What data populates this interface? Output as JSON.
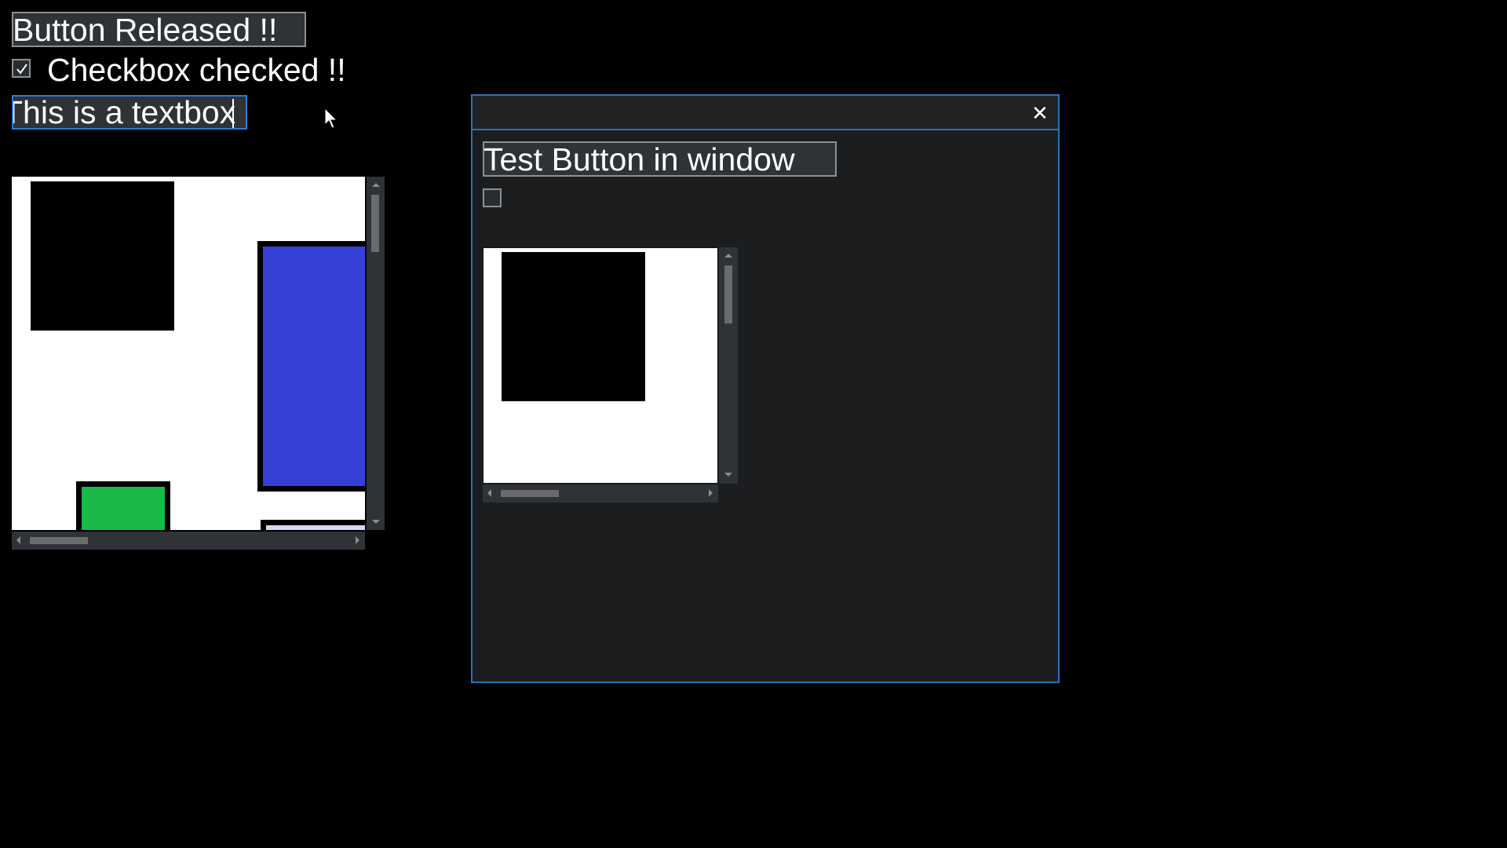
{
  "main": {
    "button_label": "Button Released !!",
    "checkbox_label": "Checkbox checked !!",
    "checkbox_checked": true,
    "textbox_value": "This is a textbox"
  },
  "canvas_panel": {
    "shapes": [
      {
        "name": "black-square",
        "fill": "#000000"
      },
      {
        "name": "blue-rectangle",
        "fill": "#3440d6"
      },
      {
        "name": "green-rectangle",
        "fill": "#18b946"
      },
      {
        "name": "lavender-rectangle",
        "fill": "#dcd6f7"
      }
    ]
  },
  "window": {
    "title": "",
    "close_label": "✕",
    "button_label": "Test Button in window",
    "checkbox_checked": false,
    "canvas_shapes": [
      {
        "name": "black-square",
        "fill": "#000000"
      }
    ]
  },
  "colors": {
    "accent": "#2d6fb8",
    "window_bg": "#1c1d1e",
    "button_bg": "#2f3236"
  }
}
